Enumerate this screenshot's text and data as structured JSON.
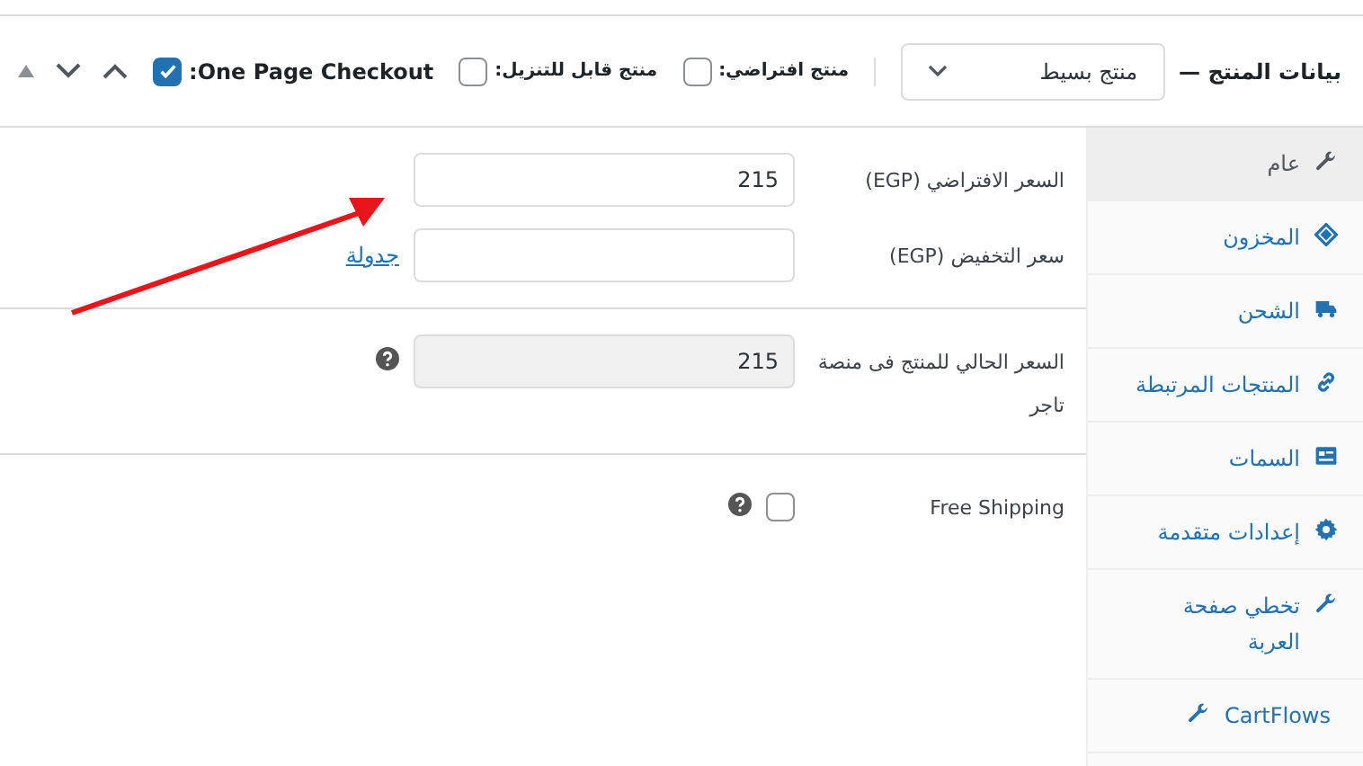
{
  "header": {
    "title": "بيانات المنتج —",
    "product_type": "منتج بسيط",
    "options": [
      {
        "label": "منتج افتراضي:",
        "checked": false
      },
      {
        "label": "منتج قابل للتنزيل:",
        "checked": false
      },
      {
        "label": "One Page Checkout:",
        "checked": true
      }
    ]
  },
  "sidebar": {
    "items": [
      {
        "label": "عام",
        "kind": "wrench",
        "selected": true
      },
      {
        "label": "المخزون",
        "kind": "tag",
        "selected": false
      },
      {
        "label": "الشحن",
        "kind": "truck",
        "selected": false
      },
      {
        "label": "المنتجات المرتبطة",
        "kind": "link",
        "selected": false
      },
      {
        "label": "السمات",
        "kind": "list",
        "selected": false
      },
      {
        "label": "إعدادات متقدمة",
        "kind": "gear",
        "selected": false
      },
      {
        "label": "تخطي صفحة العربة",
        "kind": "wrench",
        "selected": false
      },
      {
        "label": "CartFlows",
        "kind": "wrench-leading",
        "selected": false
      }
    ]
  },
  "sections": [
    {
      "fields": [
        {
          "label": "السعر الافتراضي (EGP)",
          "kind": "text",
          "value": "215",
          "disabled": false
        },
        {
          "label": "سعر التخفيض (EGP)",
          "kind": "text",
          "disabled": false,
          "link": "جدولة"
        }
      ]
    },
    {
      "fields": [
        {
          "label": "السعر الحالي للمنتج فى منصة تاجر",
          "kind": "text",
          "value": "215",
          "disabled": true,
          "help": true
        }
      ]
    },
    {
      "fields": [
        {
          "label": "Free Shipping",
          "kind": "checkbox",
          "checked": false,
          "help": true
        }
      ]
    }
  ],
  "annotation": {
    "kind": "arrow"
  }
}
